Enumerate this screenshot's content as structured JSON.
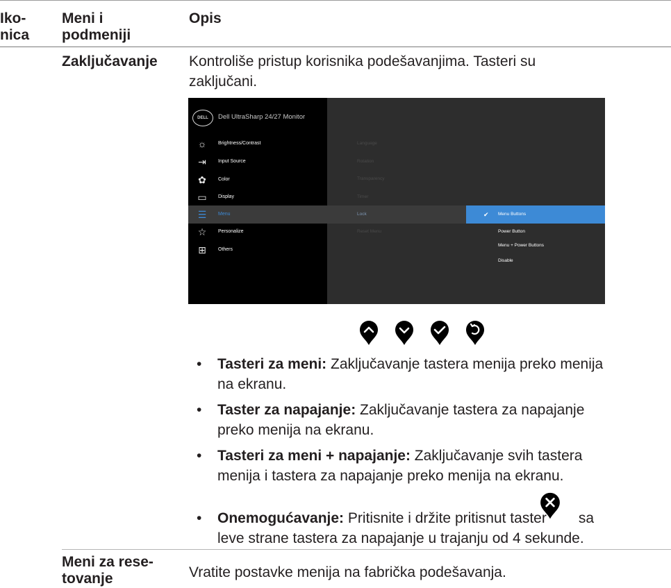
{
  "header": {
    "col1": "Iko-\nnica",
    "col1_line1": "Iko-",
    "col1_line2": "nica",
    "col2_line1": "Meni i",
    "col2_line2": "podmeniji",
    "col3": "Opis"
  },
  "lock_row": {
    "menu_name": "Zaključavanje",
    "desc_line1": "Kontroliše pristup korisnika podešavanjima. Tasteri su",
    "desc_line2": "zaključani."
  },
  "osd": {
    "logo_text": "DELL",
    "title": "Dell UltraSharp 24/27 Monitor",
    "main_menu": [
      {
        "icon": "brightness-icon",
        "label": "Brightness/Contrast"
      },
      {
        "icon": "input-source-icon",
        "label": "Input Source"
      },
      {
        "icon": "color-icon",
        "label": "Color"
      },
      {
        "icon": "display-icon",
        "label": "Display"
      },
      {
        "icon": "menu-icon",
        "label": "Menu"
      },
      {
        "icon": "star-icon",
        "label": "Personalize"
      },
      {
        "icon": "others-icon",
        "label": "Others"
      }
    ],
    "active_main": "Menu",
    "submenu": [
      "Language",
      "Rotation",
      "Transparency",
      "Timer",
      "Lock",
      "Reset Menu"
    ],
    "active_submenu": "Lock",
    "options": [
      "Menu Buttons",
      "Power Button",
      "Menu + Power Buttons",
      "Disable"
    ],
    "selected_option": "Menu Buttons",
    "accent_color": "#3d8ad6"
  },
  "control_buttons": [
    "up-chevron-icon",
    "down-chevron-icon",
    "check-icon",
    "back-icon"
  ],
  "bullets": [
    {
      "term": "Tasteri za meni:",
      "line1": " Zaključavanje tastera menija preko menija",
      "line2": "na ekranu."
    },
    {
      "term": "Taster za napajanje:",
      "line1": " Zaključavanje tastera za napajanje",
      "line2": "preko menija na ekranu."
    },
    {
      "term": "Tasteri za meni + napajanje:",
      "line1": " Zaključavanje svih tastera",
      "line2": "menija i tastera za napajanje preko menija na ekranu."
    },
    {
      "term": "Onemogućavanje:",
      "line1": " Pritisnite i držite pritisnut taster",
      "line1_after": "sa",
      "line2": "leve strane tastera za napajanje u trajanju od 4 sekunde."
    }
  ],
  "reset_row": {
    "menu_name_line1": "Meni za rese-",
    "menu_name_line2": "tovanje",
    "desc": "Vratite postavke menija na fabrička podešavanja."
  }
}
